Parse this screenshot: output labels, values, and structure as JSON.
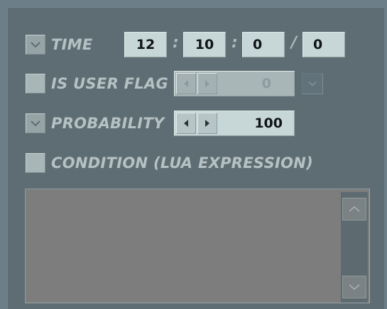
{
  "time": {
    "label": "TIME",
    "checked": true,
    "hours": "12",
    "minutes": "10",
    "seconds": "0",
    "frames": "0",
    "sep1": ":",
    "sep2": ":",
    "sep3": "/"
  },
  "user_flag": {
    "label": "IS USER FLAG",
    "checked": false,
    "value": "0",
    "disabled": true
  },
  "probability": {
    "label": "PROBABILITY",
    "checked": true,
    "value": "100"
  },
  "condition": {
    "label": "CONDITION (LUA EXPRESSION)",
    "checked": false,
    "text": ""
  },
  "icons": {
    "check": "checkmark-icon",
    "left": "left-arrow-icon",
    "right": "right-arrow-icon",
    "down": "chevron-down-icon",
    "up": "chevron-up-icon"
  }
}
